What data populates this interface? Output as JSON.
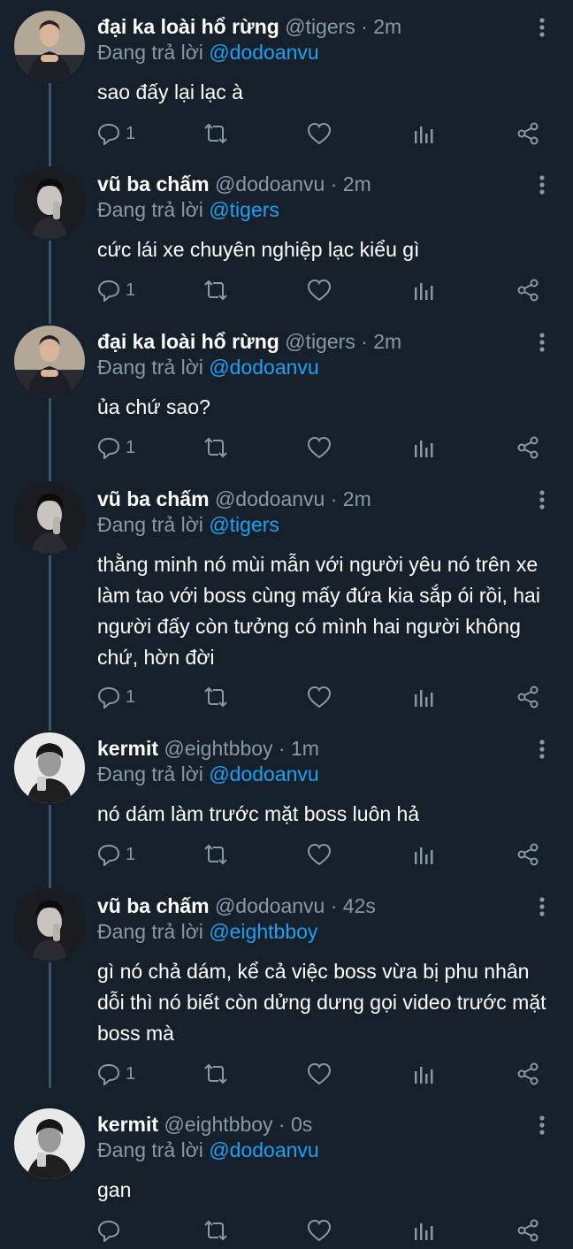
{
  "colors": {
    "background": "#15202b",
    "text": "#ffffff",
    "muted": "#8899a6",
    "link": "#1da1f2",
    "thread_line": "#3d5466"
  },
  "icons": {
    "more": "more-vertical-icon",
    "reply": "reply-icon",
    "retweet": "retweet-icon",
    "like": "heart-icon",
    "stats": "analytics-icon",
    "share": "share-icon"
  },
  "tweets": [
    {
      "name": "đại ka loài hổ rừng",
      "handle": "@tigers",
      "sep": " · ",
      "time": "2m",
      "replying_prefix": "Đang trả lời ",
      "replying_to": "@dodoanvu",
      "text": "sao đấy lại lạc à",
      "reply_count": "1"
    },
    {
      "name": "vũ ba chấm",
      "handle": "@dodoanvu",
      "sep": " · ",
      "time": "2m",
      "replying_prefix": "Đang trả lời ",
      "replying_to": "@tigers",
      "text": "cức lái xe chuyên nghiệp lạc kiểu gì",
      "reply_count": "1"
    },
    {
      "name": "đại ka loài hổ rừng",
      "handle": "@tigers",
      "sep": " · ",
      "time": "2m",
      "replying_prefix": "Đang trả lời ",
      "replying_to": "@dodoanvu",
      "text": "ủa chứ sao?",
      "reply_count": "1"
    },
    {
      "name": "vũ ba chấm",
      "handle": "@dodoanvu",
      "sep": " · ",
      "time": "2m",
      "replying_prefix": "Đang trả lời ",
      "replying_to": "@tigers",
      "text": "thằng minh nó mùi mẫn với người yêu nó trên xe làm tao với boss cùng mấy đứa kia sắp ói rồi, hai người đấy còn tưởng có mình hai người không chứ, hờn đời",
      "reply_count": "1"
    },
    {
      "name": "kermit",
      "handle": "@eightbboy",
      "sep": " · ",
      "time": "1m",
      "replying_prefix": "Đang trả lời ",
      "replying_to": "@dodoanvu",
      "text": "nó dám làm trước mặt boss luôn hả",
      "reply_count": "1"
    },
    {
      "name": "vũ ba chấm",
      "handle": "@dodoanvu",
      "sep": " · ",
      "time": "42s",
      "replying_prefix": "Đang trả lời ",
      "replying_to": "@eightbboy",
      "text": "gì nó chả dám, kể cả việc boss vừa bị phu nhân dỗi thì nó biết còn dửng dưng gọi video trước mặt boss mà",
      "reply_count": "1"
    },
    {
      "name": "kermit",
      "handle": "@eightbboy",
      "sep": " · ",
      "time": "0s",
      "replying_prefix": "Đang trả lời ",
      "replying_to": "@dodoanvu",
      "text": "gan",
      "reply_count": ""
    }
  ]
}
